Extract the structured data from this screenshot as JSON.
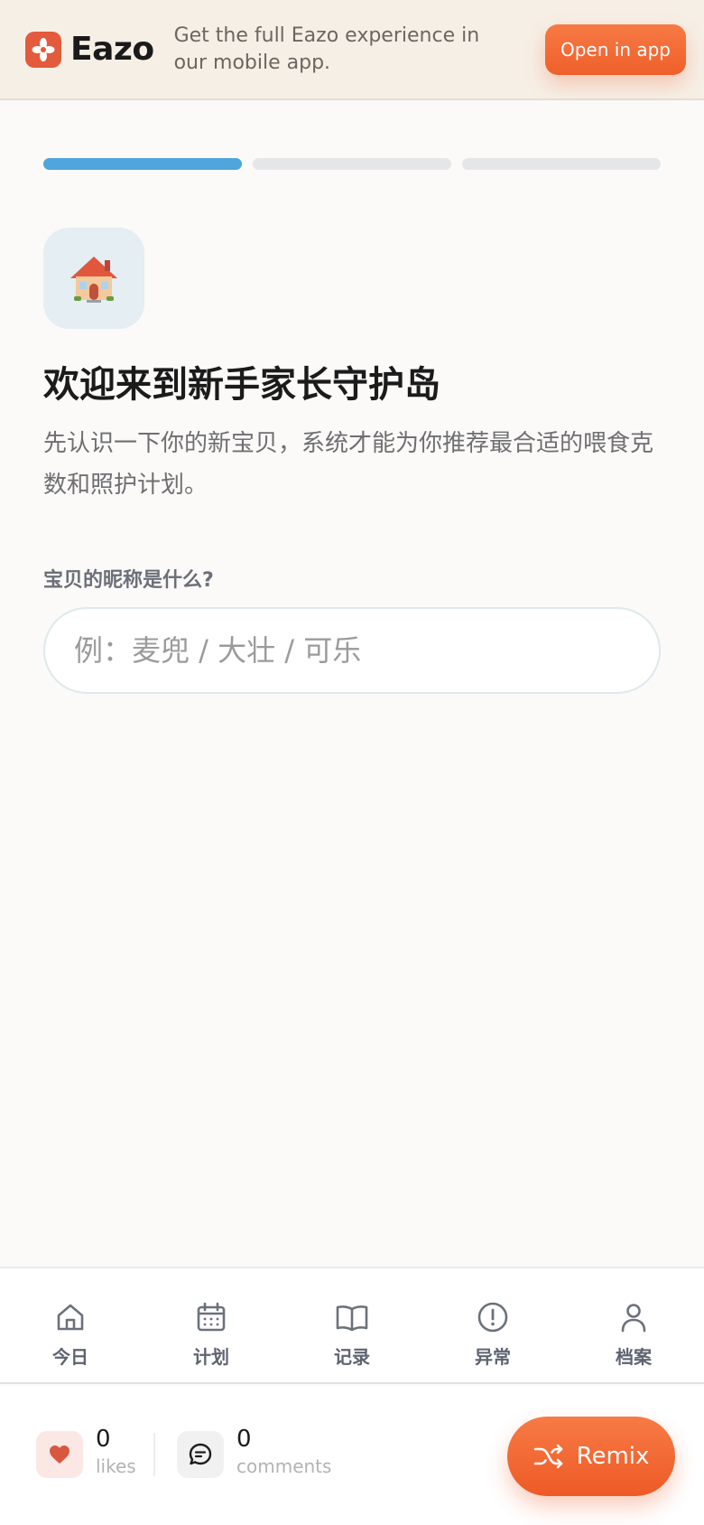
{
  "banner": {
    "brand_name": "Eazo",
    "message": "Get the full Eazo experience in our mobile app.",
    "open_button": "Open in app",
    "brand_color": "#e35a3d"
  },
  "onboarding": {
    "steps_total": 3,
    "step_current": 1,
    "hero_icon": "house-icon",
    "title": "欢迎来到新手家长守护岛",
    "subtitle": "先认识一下你的新宝贝，系统才能为你推荐最合适的喂食克数和照护计划。",
    "name_label": "宝贝的昵称是什么?",
    "name_value": "",
    "name_placeholder": "例：麦兜 / 大壮 / 可乐",
    "progress_color": "#4fa5dc"
  },
  "tabbar": {
    "items": [
      {
        "label": "今日",
        "icon": "home-icon"
      },
      {
        "label": "计划",
        "icon": "calendar-icon"
      },
      {
        "label": "记录",
        "icon": "book-icon"
      },
      {
        "label": "异常",
        "icon": "alert-icon"
      },
      {
        "label": "档案",
        "icon": "user-icon"
      }
    ]
  },
  "social": {
    "likes": {
      "count": "0",
      "label": "likes"
    },
    "comments": {
      "count": "0",
      "label": "comments"
    },
    "remix_label": "Remix",
    "accent_color": "#ef5f2b"
  }
}
